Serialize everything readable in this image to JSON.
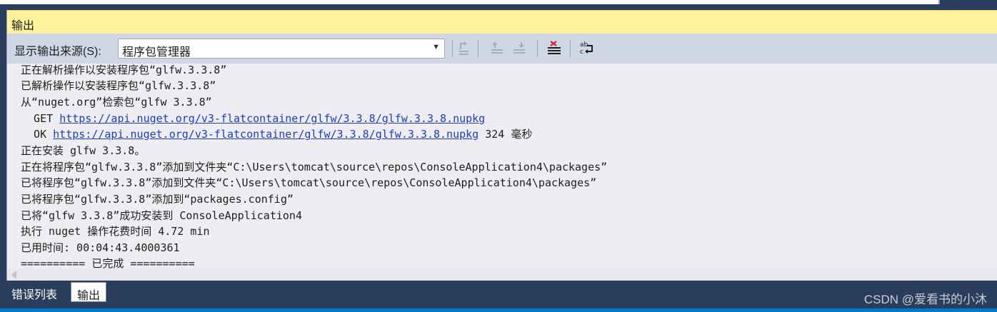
{
  "panel": {
    "title": "输出"
  },
  "toolbar": {
    "source_label": "显示输出来源(S):",
    "source_value": "程序包管理器",
    "buttons": [
      {
        "icon": "goto-source-icon"
      },
      {
        "icon": "previous-message-icon"
      },
      {
        "icon": "next-message-icon"
      },
      {
        "icon": "clear-all-icon"
      },
      {
        "icon": "word-wrap-icon"
      }
    ]
  },
  "output": {
    "lines": [
      "正在解析操作以安装程序包“glfw.3.3.8”",
      "已解析操作以安装程序包“glfw.3.3.8”",
      "从“nuget.org”检索包“glfw 3.3.8”",
      {
        "prefix": "  GET ",
        "link": "https://api.nuget.org/v3-flatcontainer/glfw/3.3.8/glfw.3.3.8.nupkg",
        "suffix": ""
      },
      {
        "prefix": "  OK ",
        "link": "https://api.nuget.org/v3-flatcontainer/glfw/3.3.8/glfw.3.3.8.nupkg",
        "suffix": " 324 毫秒"
      },
      "正在安装 glfw 3.3.8。",
      "正在将程序包“glfw.3.3.8”添加到文件夹“C:\\Users\\tomcat\\source\\repos\\ConsoleApplication4\\packages”",
      "已将程序包“glfw.3.3.8”添加到文件夹“C:\\Users\\tomcat\\source\\repos\\ConsoleApplication4\\packages”",
      "已将程序包“glfw.3.3.8”添加到“packages.config”",
      "已将“glfw 3.3.8”成功安装到 ConsoleApplication4",
      "执行 nuget 操作花费时间 4.72 min",
      "已用时间: 00:04:43.4000361",
      "========== 已完成 =========="
    ]
  },
  "tabs": [
    {
      "label": "错误列表",
      "active": false
    },
    {
      "label": "输出",
      "active": true
    }
  ],
  "watermark": "CSDN @爱看书的小沐"
}
